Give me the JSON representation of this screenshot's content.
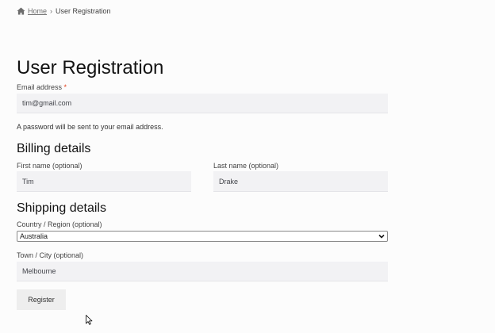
{
  "breadcrumb": {
    "home": "Home",
    "separator": "›",
    "current": "User Registration"
  },
  "page": {
    "title": "User Registration"
  },
  "form": {
    "email_label": "Email address",
    "email_required_mark": "*",
    "email_value": "tim@gmail.com",
    "password_note": "A password will be sent to your email address.",
    "billing_heading": "Billing details",
    "first_name_label": "First name (optional)",
    "first_name_value": "Tim",
    "last_name_label": "Last name (optional)",
    "last_name_value": "Drake",
    "shipping_heading": "Shipping details",
    "country_label": "Country / Region (optional)",
    "country_value": "Australia",
    "city_label": "Town / City (optional)",
    "city_value": "Melbourne",
    "register_label": "Register"
  },
  "icons": {
    "home": "home-icon",
    "dropdown": "chevron-down-icon",
    "cursor": "mouse-pointer-icon"
  },
  "colors": {
    "background": "#fcfcfc",
    "input_background": "#f2f2f4",
    "button_background": "#eeeeee",
    "required_mark": "#e2401c",
    "heading": "#131313"
  }
}
